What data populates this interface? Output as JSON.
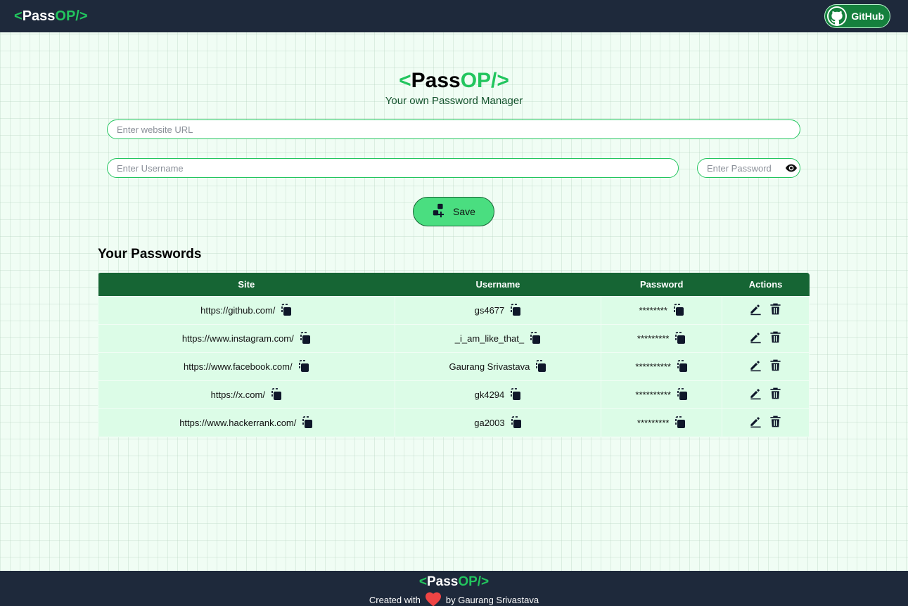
{
  "navbar": {
    "logo": {
      "open": "<",
      "pass": "Pass",
      "op": "OP/>"
    },
    "github_label": "GitHub"
  },
  "header": {
    "logo": {
      "open": "<",
      "pass": "Pass",
      "op": "OP/>"
    },
    "tagline": "Your own Password Manager"
  },
  "form": {
    "url_placeholder": "Enter website URL",
    "username_placeholder": "Enter Username",
    "password_placeholder": "Enter Password",
    "save_label": "Save"
  },
  "passwords": {
    "title": "Your Passwords",
    "columns": [
      "Site",
      "Username",
      "Password",
      "Actions"
    ],
    "rows": [
      {
        "site": "https://github.com/",
        "username": "gs4677",
        "password": "********"
      },
      {
        "site": "https://www.instagram.com/",
        "username": "_i_am_like_that_",
        "password": "*********"
      },
      {
        "site": "https://www.facebook.com/",
        "username": "Gaurang Srivastava",
        "password": "**********"
      },
      {
        "site": "https://x.com/",
        "username": "gk4294",
        "password": "**********"
      },
      {
        "site": "https://www.hackerrank.com/",
        "username": "ga2003",
        "password": "*********"
      }
    ]
  },
  "footer": {
    "logo": {
      "open": "<",
      "pass": "Pass",
      "op": "OP/>"
    },
    "created_with": "Created with",
    "by": "by Gaurang Srivastava"
  },
  "icons": {
    "github": "github-icon",
    "eye": "eye-icon",
    "save": "save-add-icon",
    "copy": "copy-icon",
    "edit": "edit-icon",
    "delete": "delete-icon",
    "heart": "heart-icon"
  },
  "colors": {
    "nav_bg": "#1e293b",
    "accent": "#22c55e",
    "table_header": "#166534",
    "row_bg": "#dcfce7",
    "save_bg": "#4ade80",
    "heart": "#ef4444"
  }
}
